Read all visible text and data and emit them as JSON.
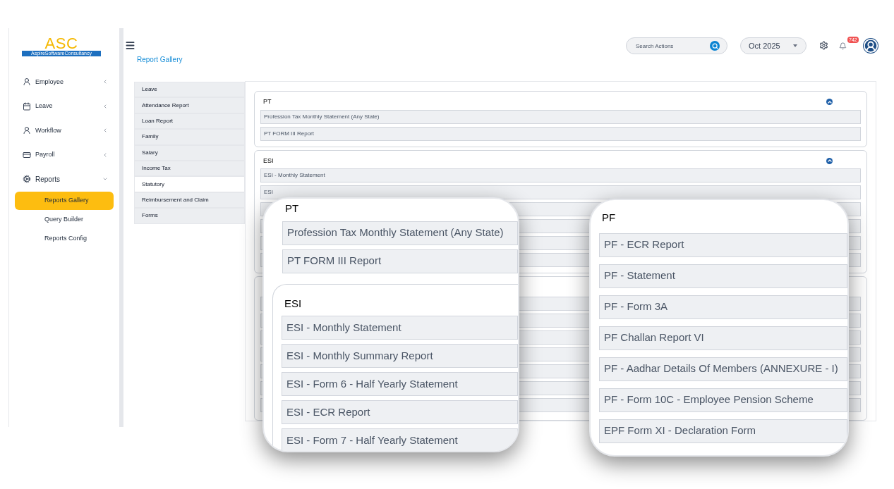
{
  "logo": {
    "mark": "ASC",
    "tagline": "AspireSoftwareConsultancy"
  },
  "header": {
    "search": {
      "placeholder": "Search Actions"
    },
    "period": "Oct 2025",
    "notification_count": "742"
  },
  "sidebar": {
    "items": [
      {
        "label": "Employee",
        "kind": "person",
        "expanded": false
      },
      {
        "label": "Leave",
        "kind": "calendar",
        "expanded": false
      },
      {
        "label": "Workflow",
        "kind": "person",
        "expanded": false
      },
      {
        "label": "Payroll",
        "kind": "card",
        "expanded": false
      },
      {
        "label": "Reports",
        "kind": "gear",
        "expanded": true,
        "children": [
          {
            "label": "Reports Gallery",
            "selected": true
          },
          {
            "label": "Query Builder",
            "selected": false
          },
          {
            "label": "Reports Config",
            "selected": false
          }
        ]
      }
    ]
  },
  "page_title": "Report Gallery",
  "categories": [
    {
      "label": "Leave",
      "selected": false
    },
    {
      "label": "Attendance Report",
      "selected": false
    },
    {
      "label": "Loan Report",
      "selected": false
    },
    {
      "label": "Family",
      "selected": false
    },
    {
      "label": "Salary",
      "selected": false
    },
    {
      "label": "Income Tax",
      "selected": false
    },
    {
      "label": "Statutory",
      "selected": true
    },
    {
      "label": "Reimbursement and Claim",
      "selected": false
    },
    {
      "label": "Forms",
      "selected": false
    }
  ],
  "sections": [
    {
      "title": "PT",
      "expanded": true,
      "items": [
        "Profession Tax Monthly Statement (Any State)",
        "PT FORM III Report"
      ]
    },
    {
      "title": "ESI",
      "expanded": true,
      "items": [
        "ESI - Monthly Statement",
        "ESI"
      ]
    }
  ],
  "callouts": [
    {
      "sections": [
        {
          "title": "PT",
          "items": [
            "Profession Tax Monthly Statement (Any State)",
            "PT FORM III Report"
          ]
        },
        {
          "title": "ESI",
          "items": [
            "ESI - Monthly Statement",
            "ESI - Monthly Summary Report",
            "ESI - Form 6 - Half Yearly Statement",
            "ESI - ECR Report",
            "ESI - Form 7 - Half Yearly Statement"
          ]
        }
      ]
    },
    {
      "sections": [
        {
          "title": "PF",
          "items": [
            "PF - ECR Report",
            "PF - Statement",
            "PF - Form 3A",
            "PF Challan Report VI",
            "PF - Aadhar Details Of Members (ANNEXURE - I)",
            "PF - Form 10C - Employee Pension Scheme",
            "EPF Form XI - Declaration Form"
          ]
        }
      ]
    }
  ]
}
